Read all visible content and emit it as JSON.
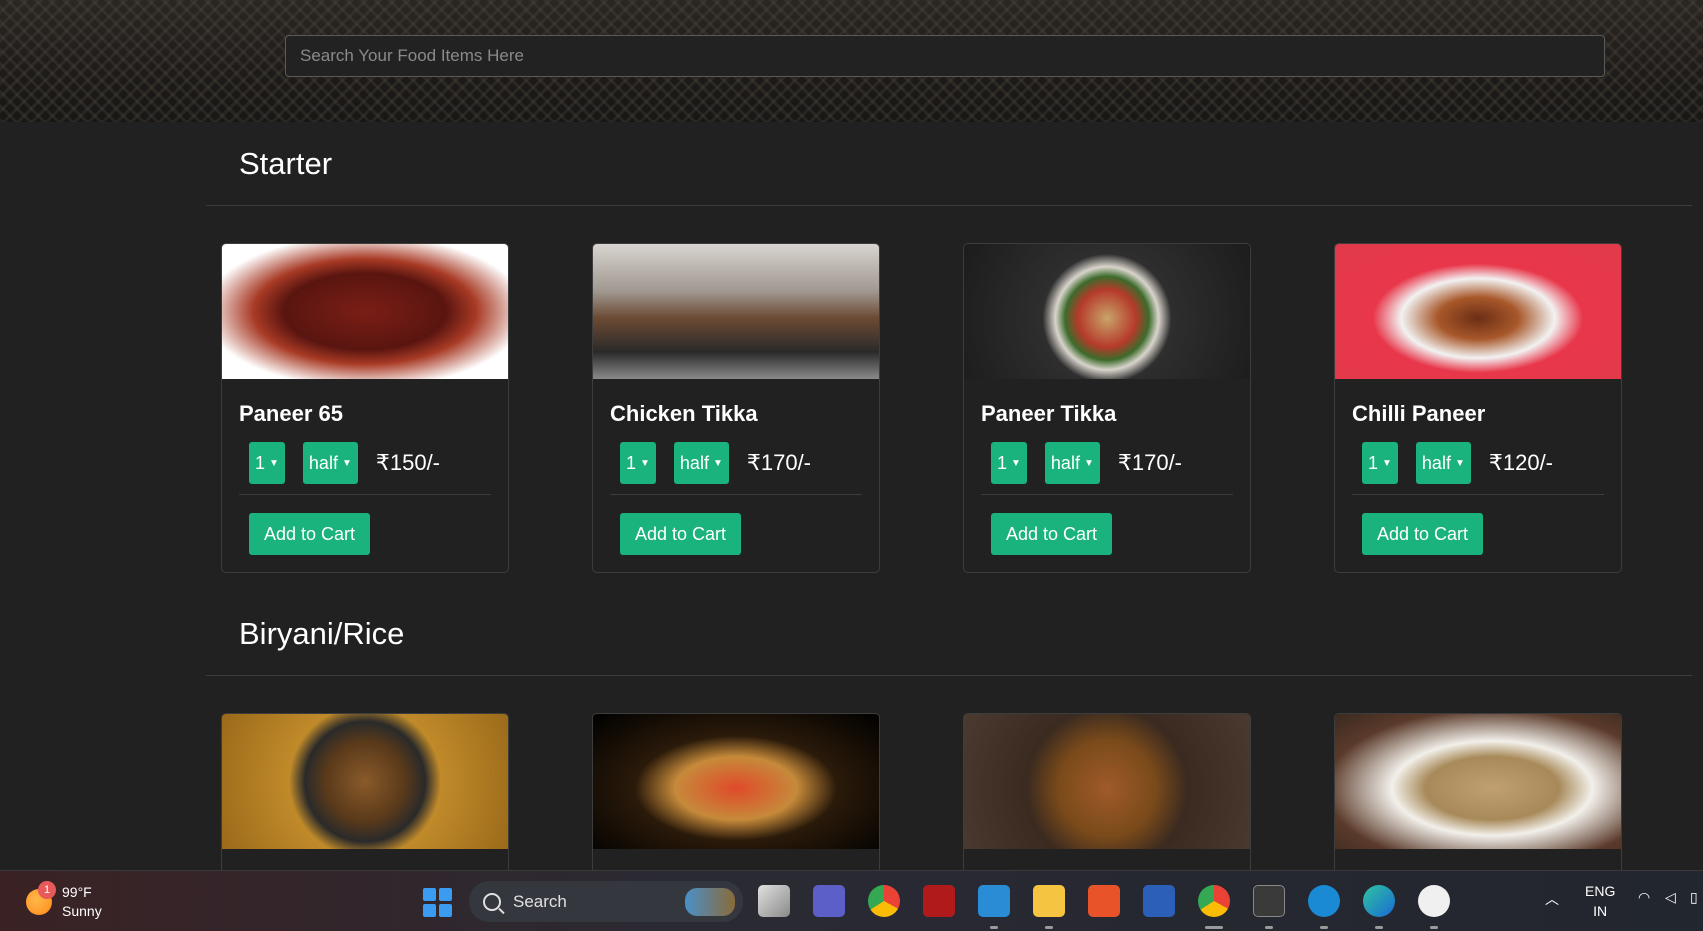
{
  "search": {
    "placeholder": "Search Your Food Items Here"
  },
  "sections": [
    {
      "title": "Starter",
      "items": [
        {
          "name": "Paneer 65",
          "qty": "1",
          "size": "half",
          "price": "₹150/-",
          "button": "Add to Cart"
        },
        {
          "name": "Chicken Tikka",
          "qty": "1",
          "size": "half",
          "price": "₹170/-",
          "button": "Add to Cart"
        },
        {
          "name": "Paneer Tikka",
          "qty": "1",
          "size": "half",
          "price": "₹170/-",
          "button": "Add to Cart"
        },
        {
          "name": "Chilli Paneer",
          "qty": "1",
          "size": "half",
          "price": "₹120/-",
          "button": "Add to Cart"
        }
      ]
    },
    {
      "title": "Biryani/Rice"
    }
  ],
  "taskbar": {
    "weather_temp": "99°F",
    "weather_desc": "Sunny",
    "weather_badge": "1",
    "search_label": "Search",
    "lang_line1": "ENG",
    "lang_line2": "IN"
  },
  "colors": {
    "accent": "#1ab37e",
    "background": "#212121"
  }
}
